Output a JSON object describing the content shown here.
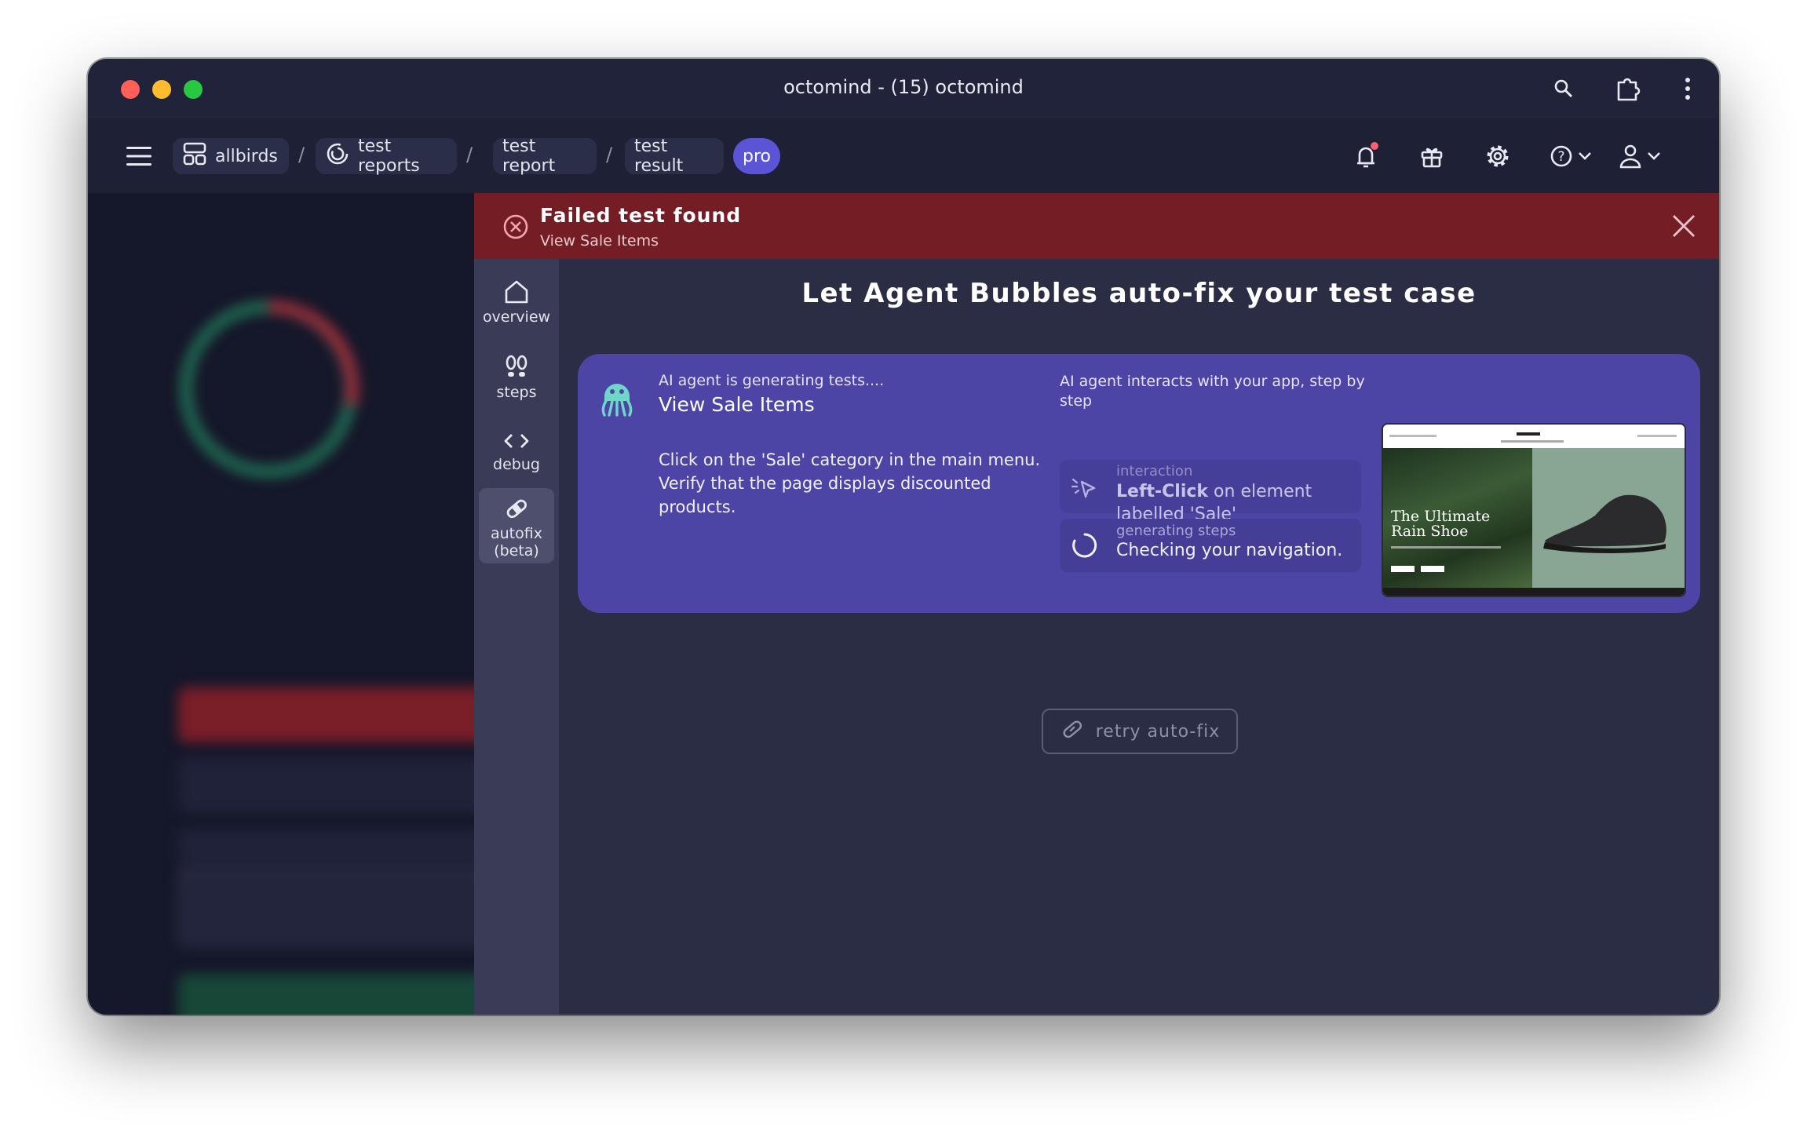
{
  "window": {
    "title": "octomind - (15) octomind"
  },
  "navbar": {
    "project": "allbirds",
    "crumbs": [
      "test reports",
      "test report",
      "test result"
    ],
    "separator": "/",
    "plan_badge": "pro"
  },
  "alert": {
    "title": "Failed test found",
    "subtitle": "View Sale Items"
  },
  "rail": {
    "overview": "overview",
    "steps": "steps",
    "debug": "debug",
    "autofix_line1": "autofix",
    "autofix_line2": "(beta)"
  },
  "main": {
    "headline": "Let Agent Bubbles auto-fix your test case",
    "agent_status": "AI agent is generating tests....",
    "test_name": "View Sale Items",
    "description": "Click on the 'Sale' category in the main menu. Verify that the page displays discounted products.",
    "interaction_caption": "AI agent interacts with your app, step by step",
    "step1": {
      "label": "interaction",
      "action": "Left-Click",
      "text": " on element labelled 'Sale'"
    },
    "step2": {
      "label": "generating steps",
      "text": "Checking your navigation."
    },
    "preview_headline_1": "The Ultimate",
    "preview_headline_2": "Rain Shoe",
    "retry_label": "retry auto-fix"
  },
  "colors": {
    "alert_bg": "#741d24",
    "card_bg": "#4d45a5",
    "pro_badge": "#5b54d6",
    "window_bg": "#1a1c33"
  }
}
